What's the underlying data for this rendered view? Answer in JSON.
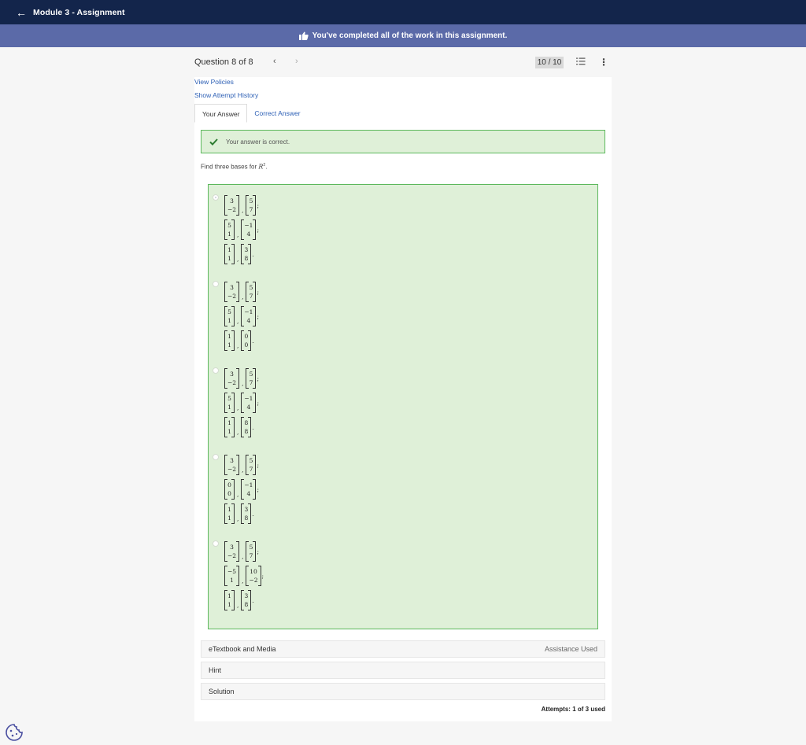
{
  "header": {
    "title": "Module 3 - Assignment",
    "back_icon": "arrow-left-icon"
  },
  "banner": {
    "text": "You've completed all of the work in this assignment.",
    "icon": "thumbs-up-icon"
  },
  "question_header": {
    "label": "Question 8 of 8",
    "prev": "‹",
    "next": "›",
    "score": "10 / 10",
    "list_icon": "list-icon",
    "menu_icon": "kebab-icon"
  },
  "links": {
    "view_policies": "View Policies",
    "attempt_history": "Show Attempt History"
  },
  "tabs": [
    {
      "label": "Your Answer",
      "active": true
    },
    {
      "label": "Correct Answer",
      "active": false
    }
  ],
  "feedback": {
    "text": "Your answer is correct.",
    "icon": "checkmark-icon",
    "color": "#5cb85c"
  },
  "question": {
    "prefix": "Find three bases for ",
    "symbol": "R",
    "exponent": "2",
    "suffix": "."
  },
  "options": [
    {
      "selected": true,
      "bases": [
        [
          [
            "3",
            "−2"
          ],
          [
            "5",
            "7"
          ]
        ],
        [
          [
            "5",
            "1"
          ],
          [
            "−1",
            "4"
          ]
        ],
        [
          [
            "1",
            "1"
          ],
          [
            "3",
            "8"
          ]
        ]
      ]
    },
    {
      "selected": false,
      "bases": [
        [
          [
            "3",
            "−2"
          ],
          [
            "5",
            "7"
          ]
        ],
        [
          [
            "5",
            "1"
          ],
          [
            "−1",
            "4"
          ]
        ],
        [
          [
            "1",
            "1"
          ],
          [
            "0",
            "0"
          ]
        ]
      ]
    },
    {
      "selected": false,
      "bases": [
        [
          [
            "3",
            "−2"
          ],
          [
            "5",
            "7"
          ]
        ],
        [
          [
            "5",
            "1"
          ],
          [
            "−1",
            "4"
          ]
        ],
        [
          [
            "1",
            "1"
          ],
          [
            "8",
            "8"
          ]
        ]
      ]
    },
    {
      "selected": false,
      "bases": [
        [
          [
            "3",
            "−2"
          ],
          [
            "5",
            "7"
          ]
        ],
        [
          [
            "0",
            "0"
          ],
          [
            "−1",
            "4"
          ]
        ],
        [
          [
            "1",
            "1"
          ],
          [
            "3",
            "8"
          ]
        ]
      ]
    },
    {
      "selected": false,
      "bases": [
        [
          [
            "3",
            "−2"
          ],
          [
            "5",
            "7"
          ]
        ],
        [
          [
            "−5",
            "1"
          ],
          [
            "10",
            "−2"
          ]
        ],
        [
          [
            "1",
            "1"
          ],
          [
            "3",
            "8"
          ]
        ]
      ]
    }
  ],
  "accordions": {
    "etextbook": "eTextbook and Media",
    "assistance": "Assistance Used",
    "hint": "Hint",
    "solution": "Solution"
  },
  "attempts": {
    "label": "Attempts:",
    "value": "1 of 3 used"
  },
  "colors": {
    "topbar": "#13254b",
    "banner": "#5b6aa8",
    "success_bg": "#dff0d8",
    "link": "#2c5fb5"
  }
}
